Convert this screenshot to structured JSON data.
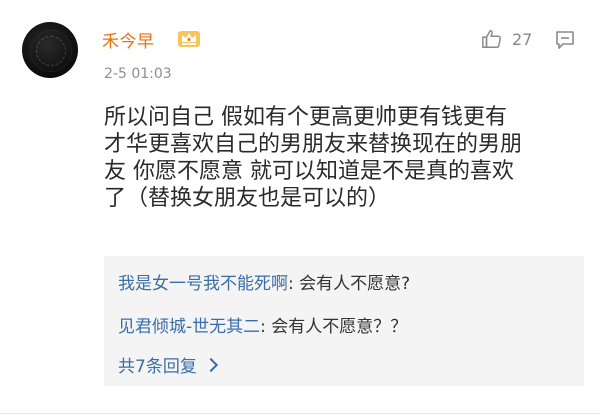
{
  "comment": {
    "username": "禾今早",
    "timestamp": "2-5 01:03",
    "likes": "27",
    "text": "所以问自己 假如有个更高更帅更有钱更有\n才华更喜欢自己的男朋友来替换现在的男朋\n友 你愿不愿意 就可以知道是不是真的喜欢\n了（替换女朋友也是可以的）"
  },
  "replies": [
    {
      "name": "我是女一号我不能死啊",
      "separator": ": ",
      "text": "会有人不愿意?"
    },
    {
      "name": "见君倾城-世无其二",
      "separator": ": ",
      "text": "会有人不愿意？？"
    }
  ],
  "more_replies_label": "共7条回复",
  "icons": {
    "vip": "crown-vip-icon",
    "like": "thumbs-up-icon",
    "comment": "comment-icon",
    "more": "chevron-right-icon"
  },
  "colors": {
    "username": "#e8730c",
    "link": "#3b6ea8",
    "reply_bg": "#f4f4f4"
  }
}
